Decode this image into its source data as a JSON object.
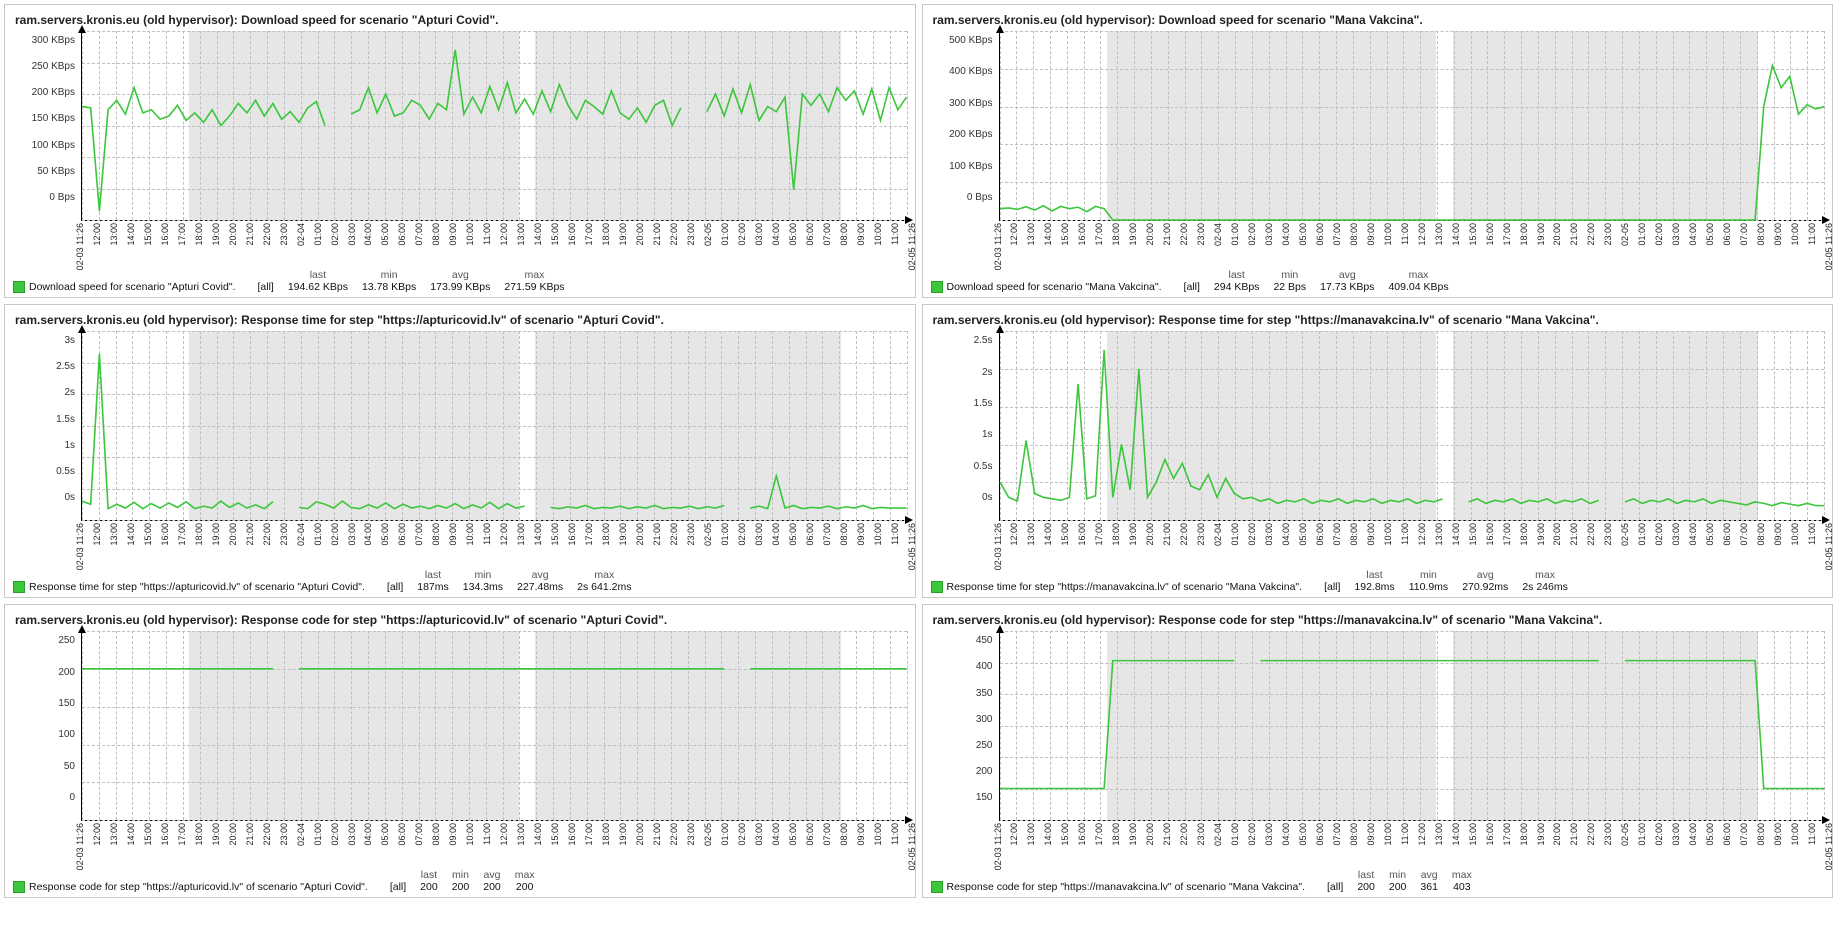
{
  "x_labels": [
    "02-03 11:26",
    "12:00",
    "13:00",
    "14:00",
    "15:00",
    "16:00",
    "17:00",
    "18:00",
    "19:00",
    "20:00",
    "21:00",
    "22:00",
    "23:00",
    "02-04",
    "01:00",
    "02:00",
    "03:00",
    "04:00",
    "05:00",
    "06:00",
    "07:00",
    "08:00",
    "09:00",
    "10:00",
    "11:00",
    "12:00",
    "13:00",
    "14:00",
    "15:00",
    "16:00",
    "17:00",
    "18:00",
    "19:00",
    "20:00",
    "21:00",
    "22:00",
    "23:00",
    "02-05",
    "01:00",
    "02:00",
    "03:00",
    "04:00",
    "05:00",
    "06:00",
    "07:00",
    "08:00",
    "09:00",
    "10:00",
    "11:00",
    "02-05 11:26"
  ],
  "nights": [
    [
      12,
      28
    ],
    [
      60,
      76
    ]
  ],
  "panels": [
    {
      "id": "p1",
      "title": "ram.servers.kronis.eu (old hypervisor): Download speed for scenario \"Apturi Covid\".",
      "y_ticks": [
        "300 KBps",
        "250 KBps",
        "200 KBps",
        "150 KBps",
        "100 KBps",
        "50 KBps",
        "0 Bps"
      ],
      "y_max": 300,
      "y_min": 0,
      "legend_name": "Download speed for scenario \"Apturi Covid\".",
      "stats": {
        "last": "194.62 KBps",
        "min": "13.78 KBps",
        "avg": "173.99 KBps",
        "max": "271.59 KBps"
      }
    },
    {
      "id": "p2",
      "title": "ram.servers.kronis.eu (old hypervisor): Download speed for scenario \"Mana Vakcina\".",
      "y_ticks": [
        "500 KBps",
        "400 KBps",
        "300 KBps",
        "200 KBps",
        "100 KBps",
        "0 Bps"
      ],
      "y_max": 500,
      "y_min": 0,
      "legend_name": "Download speed for scenario \"Mana Vakcina\".",
      "stats": {
        "last": "294 KBps",
        "min": "22 Bps",
        "avg": "17.73 KBps",
        "max": "409.04 KBps"
      }
    },
    {
      "id": "p3",
      "title": "ram.servers.kronis.eu (old hypervisor): Response time for step \"https://apturicovid.lv\" of scenario \"Apturi Covid\".",
      "y_ticks": [
        "3s",
        "2.5s",
        "2s",
        "1.5s",
        "1s",
        "0.5s",
        "0s"
      ],
      "y_max": 3,
      "y_min": 0,
      "legend_name": "Response time for step \"https://apturicovid.lv\" of scenario \"Apturi Covid\".",
      "stats": {
        "last": "187ms",
        "min": "134.3ms",
        "avg": "227.48ms",
        "max": "2s 641.2ms"
      }
    },
    {
      "id": "p4",
      "title": "ram.servers.kronis.eu (old hypervisor): Response time for step \"https://manavakcina.lv\" of scenario \"Mana Vakcina\".",
      "y_ticks": [
        "2.5s",
        "2s",
        "1.5s",
        "1s",
        "0.5s",
        "0s"
      ],
      "y_max": 2.5,
      "y_min": 0,
      "legend_name": "Response time for step \"https://manavakcina.lv\" of scenario \"Mana Vakcina\".",
      "stats": {
        "last": "192.8ms",
        "min": "110.9ms",
        "avg": "270.92ms",
        "max": "2s 246ms"
      }
    },
    {
      "id": "p5",
      "title": "ram.servers.kronis.eu (old hypervisor): Response code for step \"https://apturicovid.lv\" of scenario \"Apturi Covid\".",
      "y_ticks": [
        "250",
        "200",
        "150",
        "100",
        "50",
        "0"
      ],
      "y_max": 250,
      "y_min": 0,
      "legend_name": "Response code for step \"https://apturicovid.lv\" of scenario \"Apturi Covid\".",
      "stats": {
        "last": "200",
        "min": "200",
        "avg": "200",
        "max": "200"
      }
    },
    {
      "id": "p6",
      "title": "ram.servers.kronis.eu (old hypervisor): Response code for step \"https://manavakcina.lv\" of scenario \"Mana Vakcina\".",
      "y_ticks": [
        "450",
        "400",
        "350",
        "300",
        "250",
        "200",
        "150"
      ],
      "y_max": 450,
      "y_min": 150,
      "legend_name": "Response code for step \"https://manavakcina.lv\" of scenario \"Mana Vakcina\".",
      "stats": {
        "last": "200",
        "min": "200",
        "avg": "361",
        "max": "403"
      }
    }
  ],
  "stat_headers": [
    "last",
    "min",
    "avg",
    "max"
  ],
  "all_label": "[all]",
  "chart_data": [
    {
      "panel": "p1",
      "type": "line",
      "title": "Download speed for scenario \"Apturi Covid\".",
      "ylabel": "KBps",
      "ylim": [
        0,
        300
      ],
      "x_range": "02-03 11:26 to 02-05 11:26 hourly",
      "values": [
        180,
        178,
        14,
        175,
        190,
        168,
        210,
        170,
        175,
        160,
        165,
        182,
        158,
        170,
        155,
        175,
        150,
        165,
        185,
        170,
        190,
        165,
        185,
        160,
        172,
        155,
        178,
        188,
        150,
        null,
        null,
        168,
        175,
        210,
        170,
        200,
        165,
        170,
        190,
        182,
        160,
        185,
        175,
        270,
        168,
        195,
        170,
        212,
        175,
        218,
        170,
        192,
        168,
        205,
        172,
        215,
        182,
        160,
        190,
        180,
        168,
        205,
        170,
        160,
        178,
        155,
        182,
        190,
        150,
        178,
        null,
        null,
        172,
        200,
        165,
        208,
        170,
        215,
        158,
        180,
        172,
        195,
        48,
        200,
        182,
        200,
        172,
        210,
        190,
        205,
        168,
        208,
        158,
        210,
        175,
        195
      ]
    },
    {
      "panel": "p2",
      "type": "line",
      "title": "Download speed for scenario \"Mana Vakcina\".",
      "ylabel": "KBps",
      "ylim": [
        0,
        500
      ],
      "x_range": "02-03 11:26 to 02-05 11:26 hourly",
      "values": [
        30,
        32,
        28,
        35,
        26,
        38,
        24,
        36,
        30,
        34,
        22,
        36,
        30,
        0,
        0,
        0,
        0,
        0,
        0,
        0,
        0,
        0,
        0,
        0,
        0,
        0,
        0,
        0,
        0,
        0,
        0,
        0,
        0,
        0,
        0,
        0,
        0,
        0,
        0,
        0,
        0,
        0,
        0,
        0,
        0,
        0,
        0,
        0,
        0,
        0,
        0,
        0,
        0,
        0,
        0,
        0,
        0,
        0,
        0,
        0,
        0,
        0,
        0,
        0,
        0,
        0,
        0,
        0,
        0,
        0,
        0,
        0,
        0,
        0,
        0,
        0,
        0,
        0,
        0,
        0,
        0,
        0,
        0,
        0,
        0,
        0,
        0,
        0,
        300,
        409,
        350,
        380,
        280,
        305,
        294,
        300
      ]
    },
    {
      "panel": "p3",
      "type": "line",
      "title": "Response time apturicovid.lv",
      "ylabel": "seconds",
      "ylim": [
        0,
        3
      ],
      "x_range": "02-03 11:26 to 02-05 11:26 hourly",
      "values": [
        0.3,
        0.25,
        2.64,
        0.18,
        0.25,
        0.19,
        0.28,
        0.18,
        0.26,
        0.19,
        0.27,
        0.2,
        0.29,
        0.18,
        0.22,
        0.19,
        0.3,
        0.2,
        0.27,
        0.19,
        0.24,
        0.18,
        0.29,
        null,
        null,
        0.2,
        0.18,
        0.29,
        0.25,
        0.19,
        0.3,
        0.2,
        0.18,
        0.24,
        0.19,
        0.27,
        0.18,
        0.25,
        0.19,
        0.22,
        0.18,
        0.23,
        0.19,
        0.26,
        0.18,
        0.24,
        0.19,
        0.28,
        0.18,
        0.26,
        0.19,
        0.22,
        null,
        null,
        0.2,
        0.18,
        0.21,
        0.19,
        0.23,
        0.18,
        0.2,
        0.19,
        0.22,
        0.18,
        0.21,
        0.19,
        0.23,
        0.18,
        0.2,
        0.19,
        0.22,
        0.18,
        0.21,
        0.19,
        0.23,
        null,
        null,
        0.19,
        0.22,
        0.18,
        0.7,
        0.19,
        0.23,
        0.18,
        0.2,
        0.19,
        0.22,
        0.18,
        0.21,
        0.19,
        0.23,
        0.18,
        0.2,
        0.19,
        0.19,
        0.19
      ]
    },
    {
      "panel": "p4",
      "type": "line",
      "title": "Response time manavakcina.lv",
      "ylabel": "seconds",
      "ylim": [
        0,
        2.5
      ],
      "x_range": "02-03 11:26 to 02-05 11:26 hourly",
      "values": [
        0.5,
        0.3,
        0.25,
        1.05,
        0.35,
        0.3,
        0.28,
        0.26,
        0.3,
        1.8,
        0.28,
        0.32,
        2.25,
        0.3,
        1.0,
        0.4,
        2.0,
        0.3,
        0.5,
        0.8,
        0.55,
        0.75,
        0.45,
        0.4,
        0.6,
        0.3,
        0.55,
        0.35,
        0.28,
        0.3,
        0.25,
        0.28,
        0.22,
        0.26,
        0.24,
        0.28,
        0.22,
        0.26,
        0.24,
        0.28,
        0.22,
        0.26,
        0.24,
        0.28,
        0.22,
        0.26,
        0.24,
        0.28,
        0.22,
        0.26,
        0.24,
        0.28,
        null,
        null,
        0.24,
        0.28,
        0.22,
        0.26,
        0.24,
        0.28,
        0.22,
        0.26,
        0.24,
        0.28,
        0.22,
        0.26,
        0.24,
        0.28,
        0.22,
        0.26,
        null,
        null,
        0.24,
        0.28,
        0.22,
        0.26,
        0.24,
        0.28,
        0.22,
        0.26,
        0.24,
        0.28,
        0.22,
        0.26,
        0.24,
        0.22,
        0.2,
        0.24,
        0.22,
        0.19,
        0.23,
        0.21,
        0.19,
        0.22,
        0.19,
        0.19
      ]
    },
    {
      "panel": "p5",
      "type": "line",
      "title": "Response code apturicovid.lv",
      "ylabel": "",
      "ylim": [
        0,
        250
      ],
      "x_range": "02-03 11:26 to 02-05 11:26 hourly",
      "values": [
        200,
        200,
        200,
        200,
        200,
        200,
        200,
        200,
        200,
        200,
        200,
        200,
        200,
        200,
        200,
        200,
        200,
        200,
        200,
        200,
        200,
        200,
        200,
        null,
        null,
        200,
        200,
        200,
        200,
        200,
        200,
        200,
        200,
        200,
        200,
        200,
        200,
        200,
        200,
        200,
        200,
        200,
        200,
        200,
        200,
        200,
        200,
        200,
        200,
        200,
        200,
        200,
        200,
        200,
        200,
        200,
        200,
        200,
        200,
        200,
        200,
        200,
        200,
        200,
        200,
        200,
        200,
        200,
        200,
        200,
        200,
        200,
        200,
        200,
        200,
        null,
        null,
        200,
        200,
        200,
        200,
        200,
        200,
        200,
        200,
        200,
        200,
        200,
        200,
        200,
        200,
        200,
        200,
        200,
        200,
        200
      ]
    },
    {
      "panel": "p6",
      "type": "line",
      "title": "Response code manavakcina.lv",
      "ylabel": "",
      "ylim": [
        150,
        450
      ],
      "x_range": "02-03 11:26 to 02-05 11:26 hourly",
      "values": [
        200,
        200,
        200,
        200,
        200,
        200,
        200,
        200,
        200,
        200,
        200,
        200,
        200,
        403,
        403,
        403,
        403,
        403,
        403,
        403,
        403,
        403,
        403,
        403,
        403,
        403,
        403,
        403,
        null,
        null,
        403,
        403,
        403,
        403,
        403,
        403,
        403,
        403,
        403,
        403,
        403,
        403,
        403,
        403,
        403,
        403,
        403,
        403,
        403,
        403,
        403,
        403,
        403,
        403,
        403,
        403,
        403,
        403,
        403,
        403,
        403,
        403,
        403,
        403,
        403,
        403,
        403,
        403,
        403,
        403,
        null,
        null,
        403,
        403,
        403,
        403,
        403,
        403,
        403,
        403,
        403,
        403,
        403,
        403,
        403,
        403,
        403,
        403,
        200,
        200,
        200,
        200,
        200,
        200,
        200,
        200
      ]
    }
  ]
}
